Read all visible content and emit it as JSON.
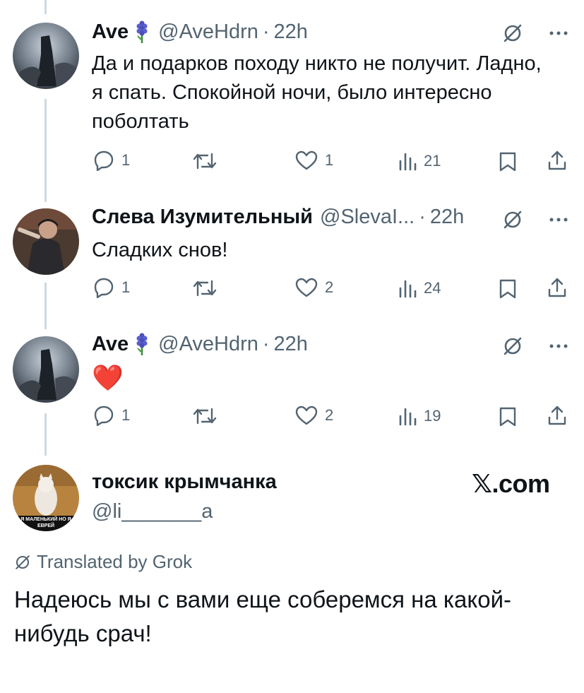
{
  "tweets": [
    {
      "name": "Ave",
      "handle": "@AveHdrn",
      "time": "22h",
      "text": "Да и подарков походу никто не получит. Ладно, я спать. Спокойной ночи, было интересно поболтать",
      "replies": "1",
      "likes": "1",
      "views": "21"
    },
    {
      "name": "Слева Изумительный",
      "handle": "@SlevaI...",
      "time": "22h",
      "text": "Сладких снов!",
      "replies": "1",
      "likes": "2",
      "views": "24"
    },
    {
      "name": "Ave",
      "handle": "@AveHdrn",
      "time": "22h",
      "text": "❤️",
      "replies": "1",
      "likes": "2",
      "views": "19"
    }
  ],
  "main_post": {
    "name": "токсик крымчанка",
    "handle": "@li_______a",
    "avatar_caption": "Я МАЛЕНЬКИЙ НО Я ЕВРЕЙ",
    "translated_label": "Translated by Grok",
    "text": "Надеюсь мы с вами еще соберемся на какой-нибудь срач!"
  },
  "watermark": "𝕏.com",
  "icons": {
    "reply": "reply-icon",
    "repost": "repost-icon",
    "like": "like-icon",
    "views": "views-icon",
    "bookmark": "bookmark-icon",
    "share": "share-icon",
    "grok": "grok-icon",
    "more": "more-icon",
    "flower": "hyacinth-icon"
  },
  "colors": {
    "text": "#0f1419",
    "muted": "#536471",
    "line": "#cfd9de",
    "heart": "#e0245e"
  }
}
